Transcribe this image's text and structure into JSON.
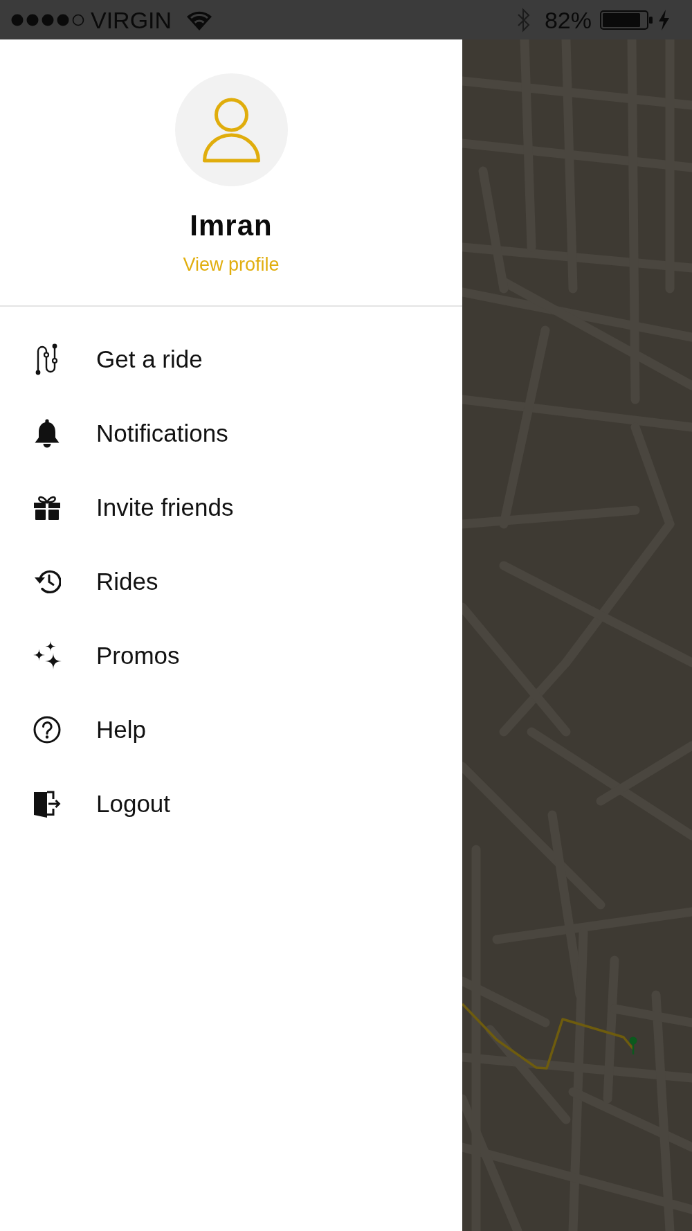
{
  "status_bar": {
    "carrier": "VIRGIN",
    "battery": "82%"
  },
  "profile": {
    "name": "Imran",
    "link": "View profile"
  },
  "menu": [
    {
      "label": "Get a ride"
    },
    {
      "label": "Notifications"
    },
    {
      "label": "Invite friends"
    },
    {
      "label": "Rides"
    },
    {
      "label": "Promos"
    },
    {
      "label": "Help"
    },
    {
      "label": "Logout"
    }
  ]
}
